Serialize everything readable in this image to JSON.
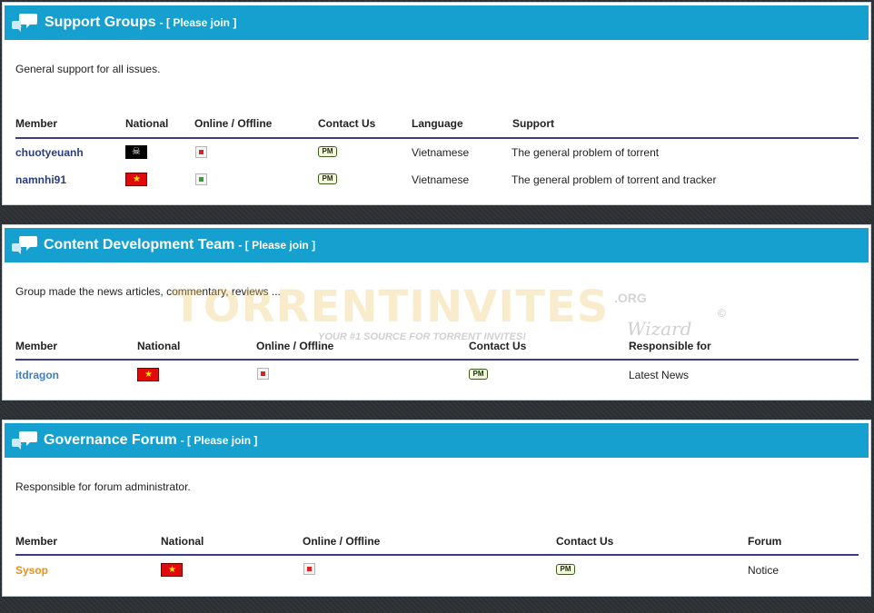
{
  "join_label": "- [ Please join ]",
  "pm_label": "PM",
  "panels": [
    {
      "title": "Support Groups",
      "description": "General support for all issues.",
      "headers": [
        "Member",
        "National",
        "Online / Offline",
        "Contact Us",
        "Language",
        "Support"
      ],
      "rows": [
        {
          "member": "chuotyeuanh",
          "flag": "pirate",
          "status": "offline",
          "language": "Vietnamese",
          "support": "The general problem of torrent"
        },
        {
          "member": "namnhi91",
          "flag": "vietnam",
          "status": "online",
          "language": "Vietnamese",
          "support": "The general problem of torrent and tracker"
        }
      ]
    },
    {
      "title": "Content Development Team",
      "description": "Group made the news articles, commentary, reviews ...",
      "headers": [
        "Member",
        "National",
        "Online / Offline",
        "Contact Us",
        "Responsible for"
      ],
      "rows": [
        {
          "member": "itdragon",
          "flag": "vietnam",
          "status": "offline",
          "responsible": "Latest News"
        }
      ]
    },
    {
      "title": "Governance Forum",
      "description": "Responsible for forum administrator.",
      "headers": [
        "Member",
        "National",
        "Online / Offline",
        "Contact Us",
        "Forum"
      ],
      "rows": [
        {
          "member": "Sysop",
          "flag": "vietnam",
          "status": "offline",
          "forum": "Notice"
        }
      ]
    }
  ],
  "watermark": {
    "brand": "TORRENTINVITES",
    "org": ".ORG",
    "slogan": "YOUR #1 SOURCE FOR TORRENT INVITES!",
    "signature": "Wizard",
    "copyright": "©"
  },
  "colors": {
    "header_blue": "#16a0d0",
    "rule": "#3c3c8c",
    "member_dark": "#2c3e7a",
    "member_blue": "#3f7ec4",
    "member_orange": "#e8901c"
  }
}
